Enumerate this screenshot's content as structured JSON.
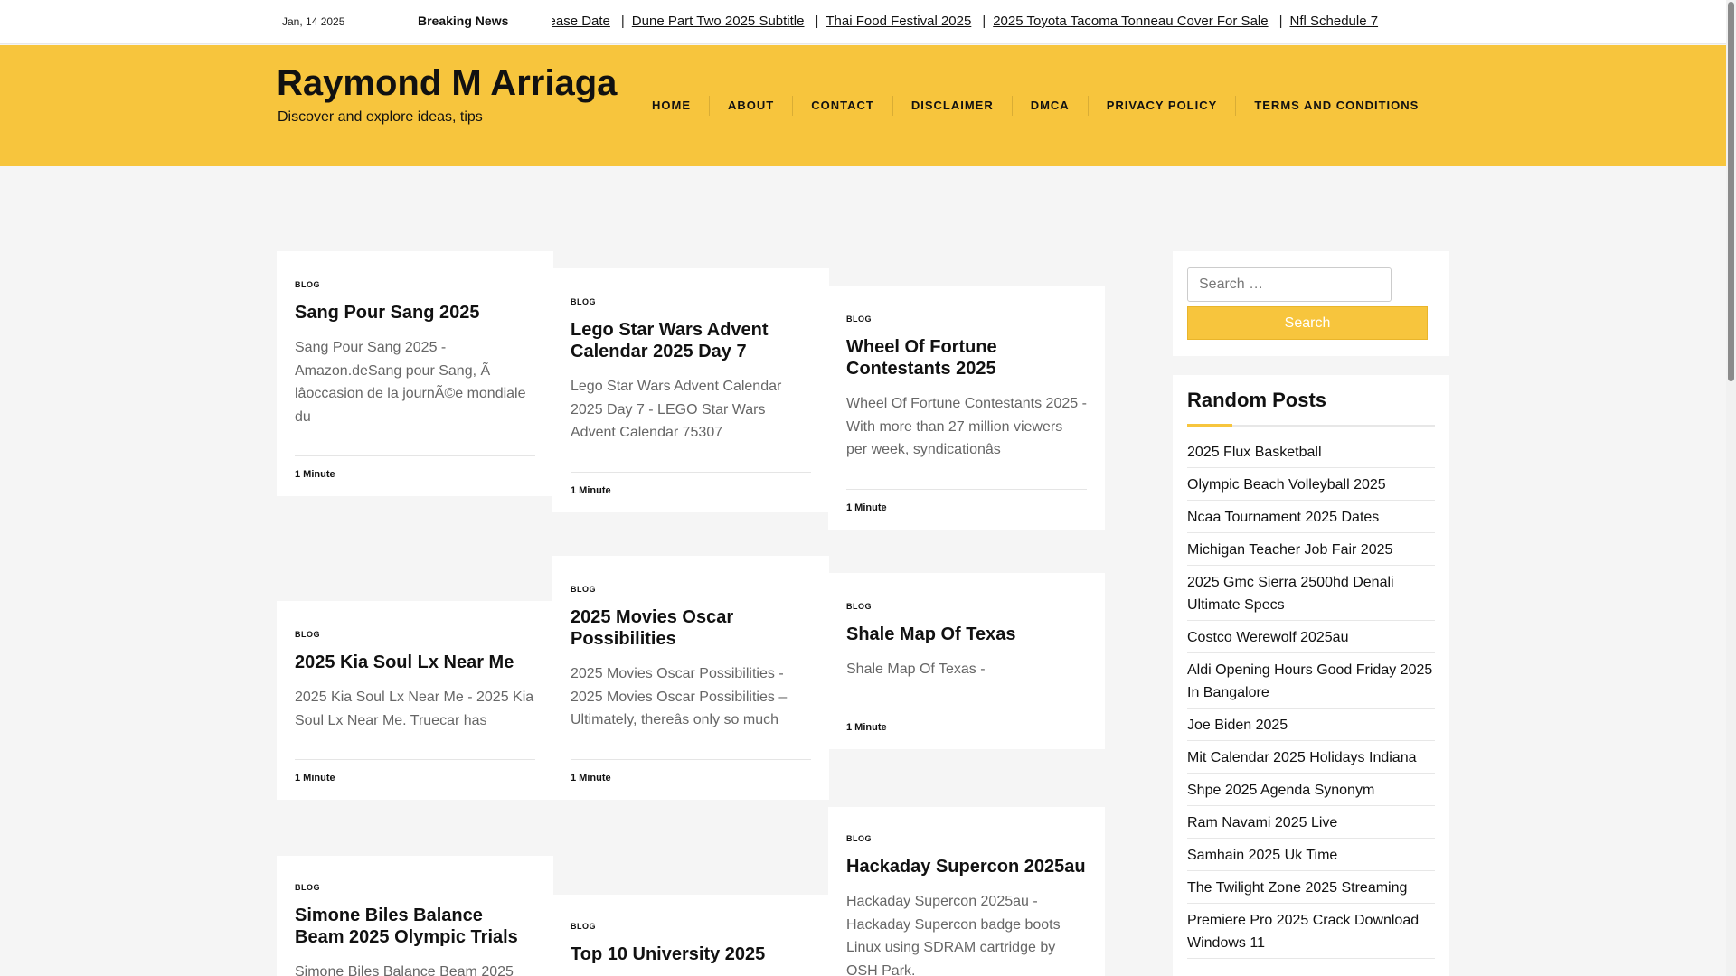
{
  "topbar": {
    "date": "Jan, 14 2025",
    "breaking_label": "Breaking News",
    "ticker": [
      "Release Date",
      "Dune Part Two 2025 Subtitle",
      "Thai Food Festival 2025",
      "2025 Toyota Tacoma Tonneau Cover For Sale",
      "Nfl Schedule 7"
    ]
  },
  "site": {
    "title": "Raymond M Arriaga",
    "description": "Discover and explore ideas, tips"
  },
  "nav": [
    "HOME",
    "ABOUT",
    "CONTACT",
    "DISCLAIMER",
    "DMCA",
    "PRIVACY POLICY",
    "TERMS AND CONDITIONS"
  ],
  "posts": [
    {
      "category": "BLOG",
      "title": "Sang Pour Sang 2025",
      "excerpt": "Sang Pour Sang 2025 - Amazon.deSang pour Sang, Ã lâoccasion de la journÃ©e mondiale du",
      "meta": "1 Minute"
    },
    {
      "category": "BLOG",
      "title": "Lego Star Wars Advent Calendar 2025 Day 7",
      "excerpt": "Lego Star Wars Advent Calendar 2025 Day 7 - LEGO Star Wars Advent Calendar 75307",
      "meta": "1 Minute"
    },
    {
      "category": "BLOG",
      "title": "Wheel Of Fortune Contestants 2025",
      "excerpt": "Wheel Of Fortune Contestants 2025 - With more than 27 million viewers per week, syndicationâs",
      "meta": "1 Minute"
    },
    {
      "category": "BLOG",
      "title": "2025 Kia Soul Lx Near Me",
      "excerpt": "2025 Kia Soul Lx Near Me - 2025 Kia Soul Lx Near Me. Truecar has",
      "meta": "1 Minute"
    },
    {
      "category": "BLOG",
      "title": "2025 Movies Oscar Possibilities",
      "excerpt": "2025 Movies Oscar Possibilities - 2025 Movies Oscar Possibilities – Ultimately, thereâs only so much",
      "meta": "1 Minute"
    },
    {
      "category": "BLOG",
      "title": "Shale Map Of Texas",
      "excerpt": "Shale Map Of Texas -",
      "meta": "1 Minute"
    },
    {
      "category": "BLOG",
      "title": "Simone Biles Balance Beam 2025 Olympic Trials",
      "excerpt": "Simone Biles Balance Beam 2025",
      "meta": ""
    },
    {
      "category": "BLOG",
      "title": "Top 10 University 2025",
      "excerpt": "",
      "meta": ""
    },
    {
      "category": "BLOG",
      "title": "Hackaday Supercon 2025au",
      "excerpt": "Hackaday Supercon 2025au - Hackaday Supercon badge boots Linux using SDRAM cartridge by OSH Park.",
      "meta": ""
    }
  ],
  "search": {
    "placeholder": "Search …",
    "button": "Search"
  },
  "random_posts": {
    "title": "Random Posts",
    "items": [
      "2025 Flux Basketball",
      "Olympic Beach Volleyball 2025",
      "Ncaa Tournament 2025 Dates",
      "Michigan Teacher Job Fair 2025",
      "2025 Gmc Sierra 2500hd Denali Ultimate Specs",
      "Costco Werewolf 2025au",
      "Aldi Opening Hours Good Friday 2025 In Bangalore",
      "Joe Biden 2025",
      "Mit Calendar 2025 Holidays Indiana",
      "Shpe 2025 Agenda Synonym",
      "Ram Navami 2025 Live",
      "Samhain 2025 Uk Time",
      "The Twilight Zone 2025 Streaming",
      "Premiere Pro 2025 Crack Download Windows 11"
    ]
  },
  "colors": {
    "accent": "#f7c53d",
    "background": "#f5f5f5"
  }
}
